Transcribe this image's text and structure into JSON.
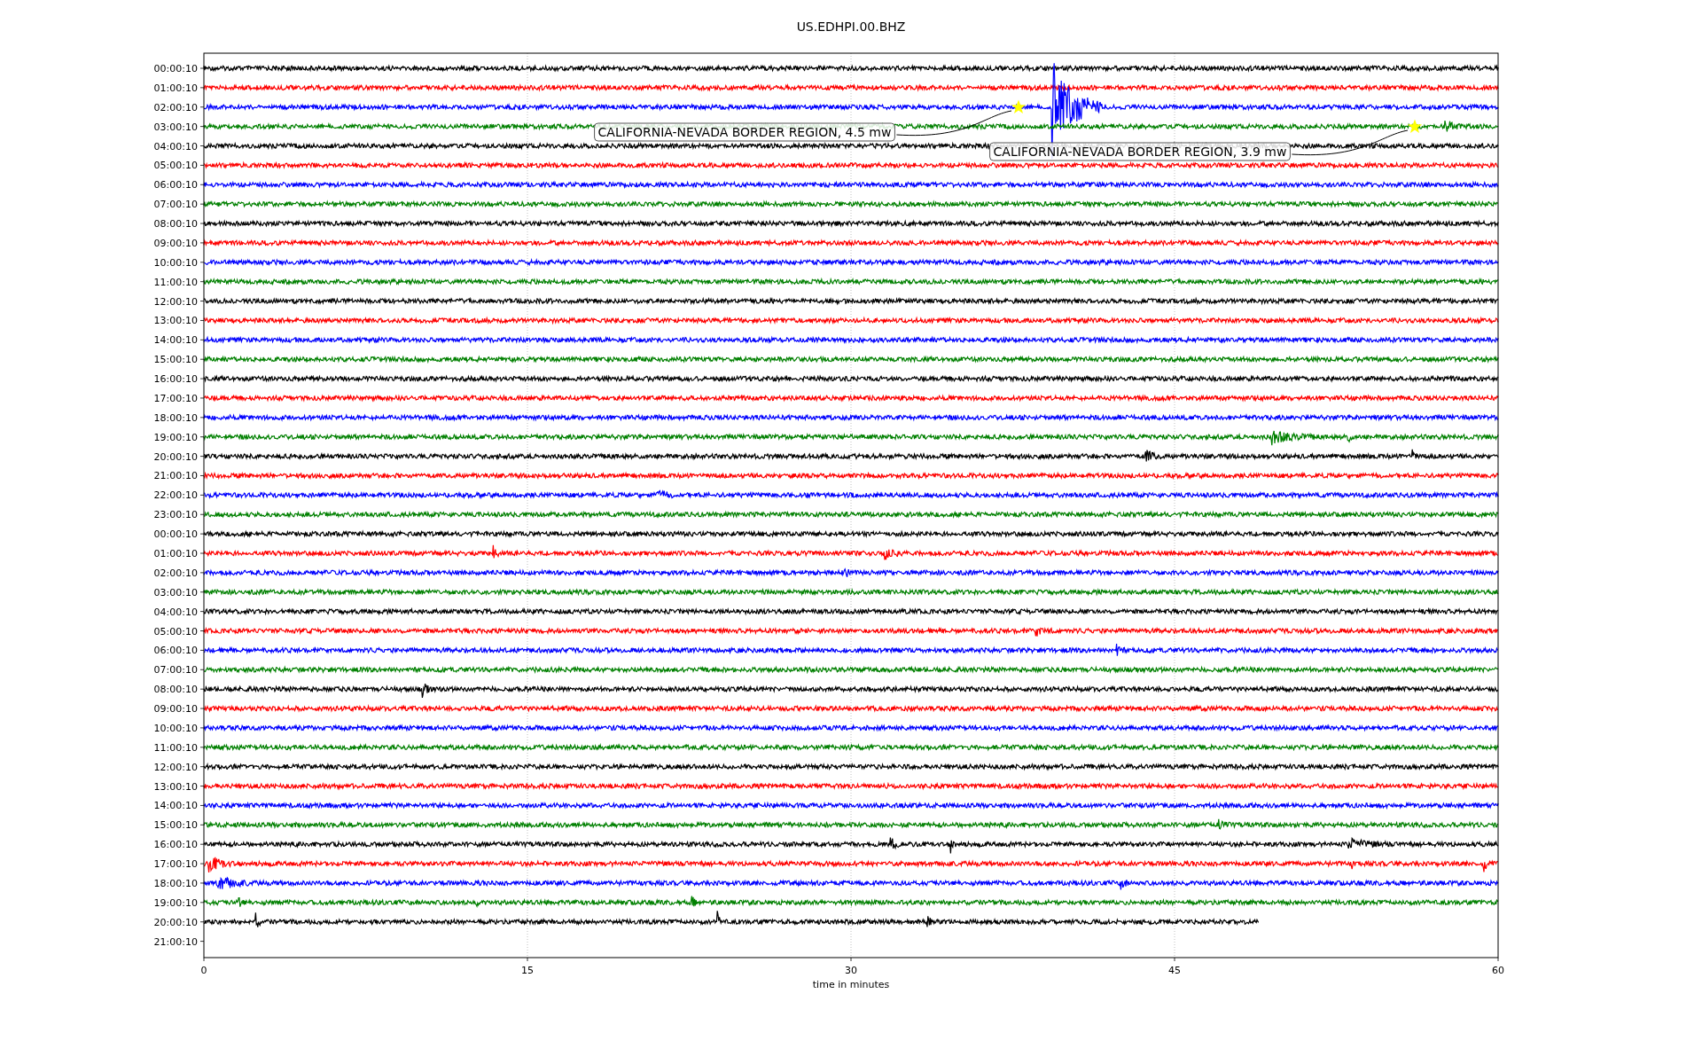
{
  "title": "US.EDHPI.00.BHZ",
  "traces": [
    {
      "label": "00:00:10",
      "color": "#000000"
    },
    {
      "label": "01:00:10",
      "color": "#ff0000"
    },
    {
      "label": "02:00:10",
      "color": "#0000ff"
    },
    {
      "label": "03:00:10",
      "color": "#008000"
    },
    {
      "label": "04:00:10",
      "color": "#000000"
    },
    {
      "label": "05:00:10",
      "color": "#ff0000"
    },
    {
      "label": "06:00:10",
      "color": "#0000ff"
    },
    {
      "label": "07:00:10",
      "color": "#008000"
    },
    {
      "label": "08:00:10",
      "color": "#000000"
    },
    {
      "label": "09:00:10",
      "color": "#ff0000"
    },
    {
      "label": "10:00:10",
      "color": "#0000ff"
    },
    {
      "label": "11:00:10",
      "color": "#008000"
    },
    {
      "label": "12:00:10",
      "color": "#000000"
    },
    {
      "label": "13:00:10",
      "color": "#ff0000"
    },
    {
      "label": "14:00:10",
      "color": "#0000ff"
    },
    {
      "label": "15:00:10",
      "color": "#008000"
    },
    {
      "label": "16:00:10",
      "color": "#000000"
    },
    {
      "label": "17:00:10",
      "color": "#ff0000"
    },
    {
      "label": "18:00:10",
      "color": "#0000ff"
    },
    {
      "label": "19:00:10",
      "color": "#008000"
    },
    {
      "label": "20:00:10",
      "color": "#000000"
    },
    {
      "label": "21:00:10",
      "color": "#ff0000"
    },
    {
      "label": "22:00:10",
      "color": "#0000ff"
    },
    {
      "label": "23:00:10",
      "color": "#008000"
    },
    {
      "label": "00:00:10",
      "color": "#000000"
    },
    {
      "label": "01:00:10",
      "color": "#ff0000"
    },
    {
      "label": "02:00:10",
      "color": "#0000ff"
    },
    {
      "label": "03:00:10",
      "color": "#008000"
    },
    {
      "label": "04:00:10",
      "color": "#000000"
    },
    {
      "label": "05:00:10",
      "color": "#ff0000"
    },
    {
      "label": "06:00:10",
      "color": "#0000ff"
    },
    {
      "label": "07:00:10",
      "color": "#008000"
    },
    {
      "label": "08:00:10",
      "color": "#000000"
    },
    {
      "label": "09:00:10",
      "color": "#ff0000"
    },
    {
      "label": "10:00:10",
      "color": "#0000ff"
    },
    {
      "label": "11:00:10",
      "color": "#008000"
    },
    {
      "label": "12:00:10",
      "color": "#000000"
    },
    {
      "label": "13:00:10",
      "color": "#ff0000"
    },
    {
      "label": "14:00:10",
      "color": "#0000ff"
    },
    {
      "label": "15:00:10",
      "color": "#008000"
    },
    {
      "label": "16:00:10",
      "color": "#000000"
    },
    {
      "label": "17:00:10",
      "color": "#ff0000"
    },
    {
      "label": "18:00:10",
      "color": "#0000ff"
    },
    {
      "label": "19:00:10",
      "color": "#008000"
    },
    {
      "label": "20:00:10",
      "color": "#000000"
    },
    {
      "label": "21:00:10"
    }
  ],
  "xticks": [
    "0",
    "15",
    "30",
    "45",
    "60"
  ],
  "xlabel": "time in minutes",
  "annotations": [
    {
      "text": "CALIFORNIA-NEVADA BORDER REGION, 4.5 mw"
    },
    {
      "text": "CALIFORNIA-NEVADA BORDER REGION, 3.9 mw"
    }
  ]
}
